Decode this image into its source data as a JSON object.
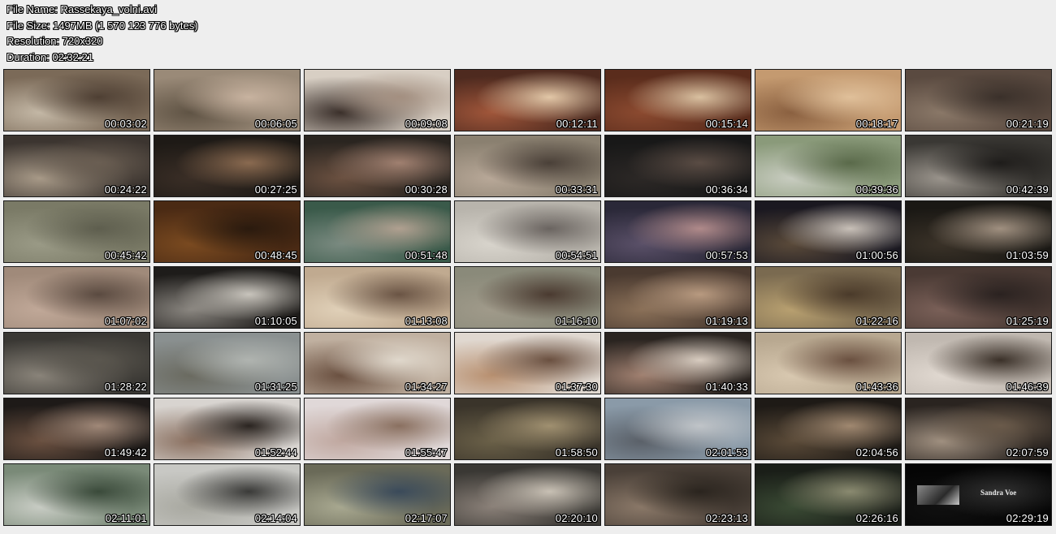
{
  "header": {
    "file_name": "File Name: Rassekaya_volni.avi",
    "file_size": "File Size: 1497MB (1 570 123 776 bytes)",
    "resolution": "Resolution: 720x320",
    "duration": "Duration: 02:32:21"
  },
  "thumbnails": [
    {
      "time": "00:03:02",
      "colors": [
        "#7b6a58",
        "#c4b8a6",
        "#4e3f33"
      ]
    },
    {
      "time": "00:06:05",
      "colors": [
        "#9a8a78",
        "#5f5344",
        "#c8b3a0"
      ]
    },
    {
      "time": "00:09:08",
      "colors": [
        "#d8cfc4",
        "#3a2f2a",
        "#a38f80"
      ]
    },
    {
      "time": "00:12:11",
      "colors": [
        "#4e2a1f",
        "#a0563a",
        "#e2c7a7"
      ]
    },
    {
      "time": "00:15:14",
      "colors": [
        "#5a2c1c",
        "#8b4a30",
        "#d9c0a0"
      ]
    },
    {
      "time": "00:18:17",
      "colors": [
        "#c49a70",
        "#8a6040",
        "#e0c09a"
      ]
    },
    {
      "time": "00:21:19",
      "colors": [
        "#5a4a40",
        "#8a7868",
        "#3a302a"
      ]
    },
    {
      "time": "00:24:22",
      "colors": [
        "#3c3530",
        "#a89a88",
        "#6a5e52"
      ]
    },
    {
      "time": "00:27:25",
      "colors": [
        "#1e1a16",
        "#3a2e26",
        "#8a6a50"
      ]
    },
    {
      "time": "00:30:28",
      "colors": [
        "#2a2520",
        "#6a5040",
        "#a08070"
      ]
    },
    {
      "time": "00:33:31",
      "colors": [
        "#8a8070",
        "#b8a898",
        "#4a4038"
      ]
    },
    {
      "time": "00:36:34",
      "colors": [
        "#181818",
        "#2c2826",
        "#5a4c44"
      ]
    },
    {
      "time": "00:39:36",
      "colors": [
        "#8a9a7a",
        "#c8ccc0",
        "#5a6a4a"
      ]
    },
    {
      "time": "00:42:39",
      "colors": [
        "#3a3834",
        "#9a948c",
        "#1e1c1a"
      ]
    },
    {
      "time": "00:45:42",
      "colors": [
        "#7a7a66",
        "#9a9a86",
        "#5e5e4e"
      ]
    },
    {
      "time": "00:48:45",
      "colors": [
        "#4a2a14",
        "#7a4a20",
        "#2a1a0e"
      ]
    },
    {
      "time": "00:51:48",
      "colors": [
        "#3a5a4a",
        "#7a8a80",
        "#b0a090"
      ]
    },
    {
      "time": "00:54:51",
      "colors": [
        "#b8b4ac",
        "#d8d4cc",
        "#6a6460"
      ]
    },
    {
      "time": "00:57:53",
      "colors": [
        "#2a2838",
        "#5a5068",
        "#b08a8a"
      ]
    },
    {
      "time": "01:00:56",
      "colors": [
        "#1a1820",
        "#5a4a3a",
        "#c8c0b8"
      ]
    },
    {
      "time": "01:03:59",
      "colors": [
        "#1a1814",
        "#3a3228",
        "#a09080"
      ]
    },
    {
      "time": "01:07:02",
      "colors": [
        "#a08a7a",
        "#c0a898",
        "#5a4a40"
      ]
    },
    {
      "time": "01:10:05",
      "colors": [
        "#1e1c1a",
        "#8a8680",
        "#c8c4bc"
      ]
    },
    {
      "time": "01:13:08",
      "colors": [
        "#c0aa90",
        "#e0d0b8",
        "#6a5444"
      ]
    },
    {
      "time": "01:16:10",
      "colors": [
        "#8a8a7a",
        "#a09a8a",
        "#4a3a30"
      ]
    },
    {
      "time": "01:19:13",
      "colors": [
        "#4a3a30",
        "#8a7058",
        "#b89a80"
      ]
    },
    {
      "time": "01:22:16",
      "colors": [
        "#7a6a50",
        "#b8a070",
        "#4a3a2a"
      ]
    },
    {
      "time": "01:25:19",
      "colors": [
        "#4a3a34",
        "#7a6058",
        "#2a2220"
      ]
    },
    {
      "time": "01:28:22",
      "colors": [
        "#3a3834",
        "#8a847a",
        "#5a564e"
      ]
    },
    {
      "time": "01:31:25",
      "colors": [
        "#8a9090",
        "#6a6a60",
        "#b0b4b0"
      ]
    },
    {
      "time": "01:34:27",
      "colors": [
        "#c0b0a0",
        "#6a5040",
        "#e0d8cc"
      ]
    },
    {
      "time": "01:37:30",
      "colors": [
        "#e0d8d0",
        "#b89070",
        "#6a5040"
      ]
    },
    {
      "time": "01:40:33",
      "colors": [
        "#2a2420",
        "#a08070",
        "#d8ccc0"
      ]
    },
    {
      "time": "01:43:36",
      "colors": [
        "#b8a890",
        "#d8c8b0",
        "#6a5040"
      ]
    },
    {
      "time": "01:46:39",
      "colors": [
        "#c0b8b0",
        "#e0d8d0",
        "#3a3028"
      ]
    },
    {
      "time": "01:49:42",
      "colors": [
        "#1e1a18",
        "#6a5040",
        "#a08878"
      ]
    },
    {
      "time": "01:52:44",
      "colors": [
        "#d8d4d0",
        "#8a7060",
        "#2a2420"
      ]
    },
    {
      "time": "01:55:47",
      "colors": [
        "#e0d8d8",
        "#c0a8a0",
        "#8a7060"
      ]
    },
    {
      "time": "01:58:50",
      "colors": [
        "#3a342a",
        "#6a6048",
        "#a09070"
      ]
    },
    {
      "time": "02:01:53",
      "colors": [
        "#8a9aa8",
        "#5a6068",
        "#c0c4c8"
      ]
    },
    {
      "time": "02:04:56",
      "colors": [
        "#1e1a16",
        "#5a4a38",
        "#a08870"
      ]
    },
    {
      "time": "02:07:59",
      "colors": [
        "#2a2420",
        "#a09080",
        "#6a5a4a"
      ]
    },
    {
      "time": "02:11:01",
      "colors": [
        "#7a8a78",
        "#c8ccc4",
        "#3a4a3a"
      ]
    },
    {
      "time": "02:14:04",
      "colors": [
        "#c8c8c4",
        "#a8a8a0",
        "#3a3a38"
      ]
    },
    {
      "time": "02:17:07",
      "colors": [
        "#6a6a58",
        "#a8a890",
        "#3a4a5a"
      ]
    },
    {
      "time": "02:20:10",
      "colors": [
        "#3a3834",
        "#8a8078",
        "#c8c0b4"
      ]
    },
    {
      "time": "02:23:13",
      "colors": [
        "#4a4038",
        "#8a7868",
        "#2a241e"
      ]
    },
    {
      "time": "02:26:16",
      "colors": [
        "#1a1e18",
        "#3a4a34",
        "#8a8a70"
      ]
    },
    {
      "time": "02:29:19",
      "colors": [
        "#050505",
        "#101010",
        "#303030"
      ]
    }
  ],
  "last_thumbnail_credit": "Sandra Voe"
}
